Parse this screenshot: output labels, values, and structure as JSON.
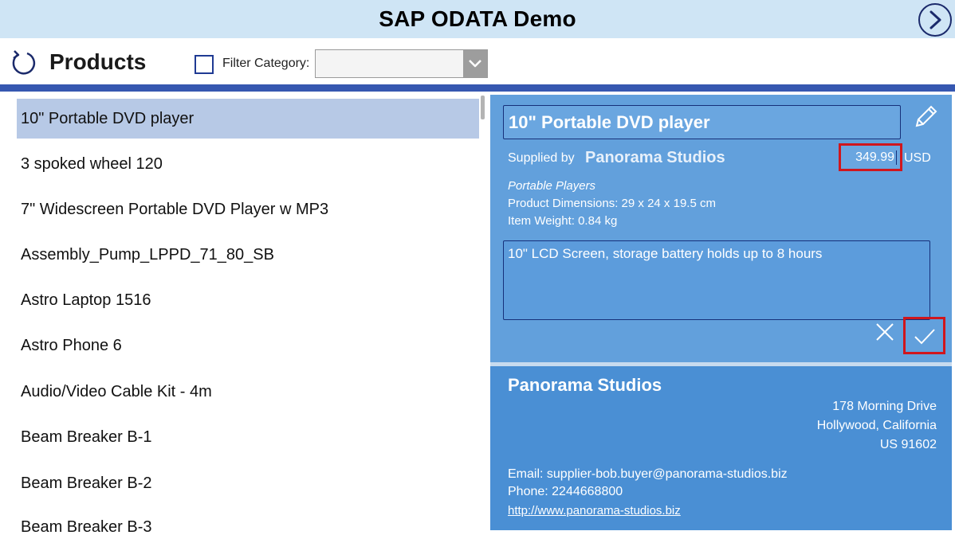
{
  "app": {
    "title": "SAP ODATA Demo",
    "next_icon": "chevron-right-circle-icon"
  },
  "toolbar": {
    "refresh_icon": "refresh-icon",
    "title": "Products",
    "filter_checked": false,
    "filter_label": "Filter Category:",
    "filter_value": ""
  },
  "products": [
    {
      "name": "10\" Portable DVD player",
      "selected": true
    },
    {
      "name": "3 spoked wheel 120",
      "selected": false
    },
    {
      "name": "7\" Widescreen Portable DVD Player w MP3",
      "selected": false
    },
    {
      "name": "Assembly_Pump_LPPD_71_80_SB",
      "selected": false
    },
    {
      "name": "Astro Laptop 1516",
      "selected": false
    },
    {
      "name": "Astro Phone 6",
      "selected": false
    },
    {
      "name": "Audio/Video Cable Kit - 4m",
      "selected": false
    },
    {
      "name": "Beam Breaker B-1",
      "selected": false
    },
    {
      "name": "Beam Breaker B-2",
      "selected": false
    },
    {
      "name": "Beam Breaker B-3",
      "selected": false
    }
  ],
  "detail": {
    "name": "10\" Portable DVD player",
    "supplied_by_label": "Supplied by",
    "supplier_name": "Panorama Studios",
    "price": "349.99",
    "currency": "USD",
    "category": "Portable Players",
    "dimensions": "Product Dimensions: 29 x 24 x 19.5 cm",
    "weight": "Item Weight: 0.84 kg",
    "description": "10\" LCD Screen, storage battery holds up to 8 hours",
    "edit_icon": "pencil-icon",
    "cancel_icon": "close-icon",
    "save_icon": "checkmark-icon"
  },
  "supplier": {
    "name": "Panorama Studios",
    "address_line1": "178 Morning Drive",
    "address_line2": "Hollywood, California",
    "address_line3": "US 91602",
    "email": "Email: supplier-bob.buyer@panorama-studios.biz",
    "phone": "Phone: 2244668800",
    "website": "http://www.panorama-studios.biz"
  },
  "colors": {
    "header_bg": "#cfe5f5",
    "accent_rule": "#3657b0",
    "selected_row": "#b7c9e6",
    "detail_bg": "#62a0dc",
    "supplier_bg": "#4a8fd4",
    "highlight_red": "#d0161d"
  }
}
